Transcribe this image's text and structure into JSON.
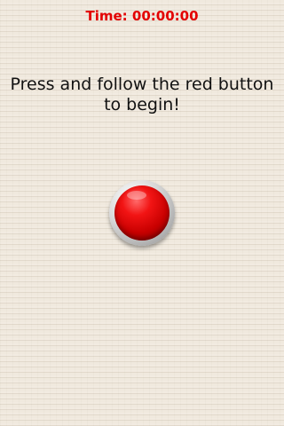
{
  "timer": {
    "label": "Time:",
    "value": "00:00:00",
    "color": "#e30000"
  },
  "instructions": {
    "line1": "Press and follow the red button",
    "line2": "to begin!"
  },
  "button": {
    "icon": "red-button",
    "color": "#e00000"
  }
}
